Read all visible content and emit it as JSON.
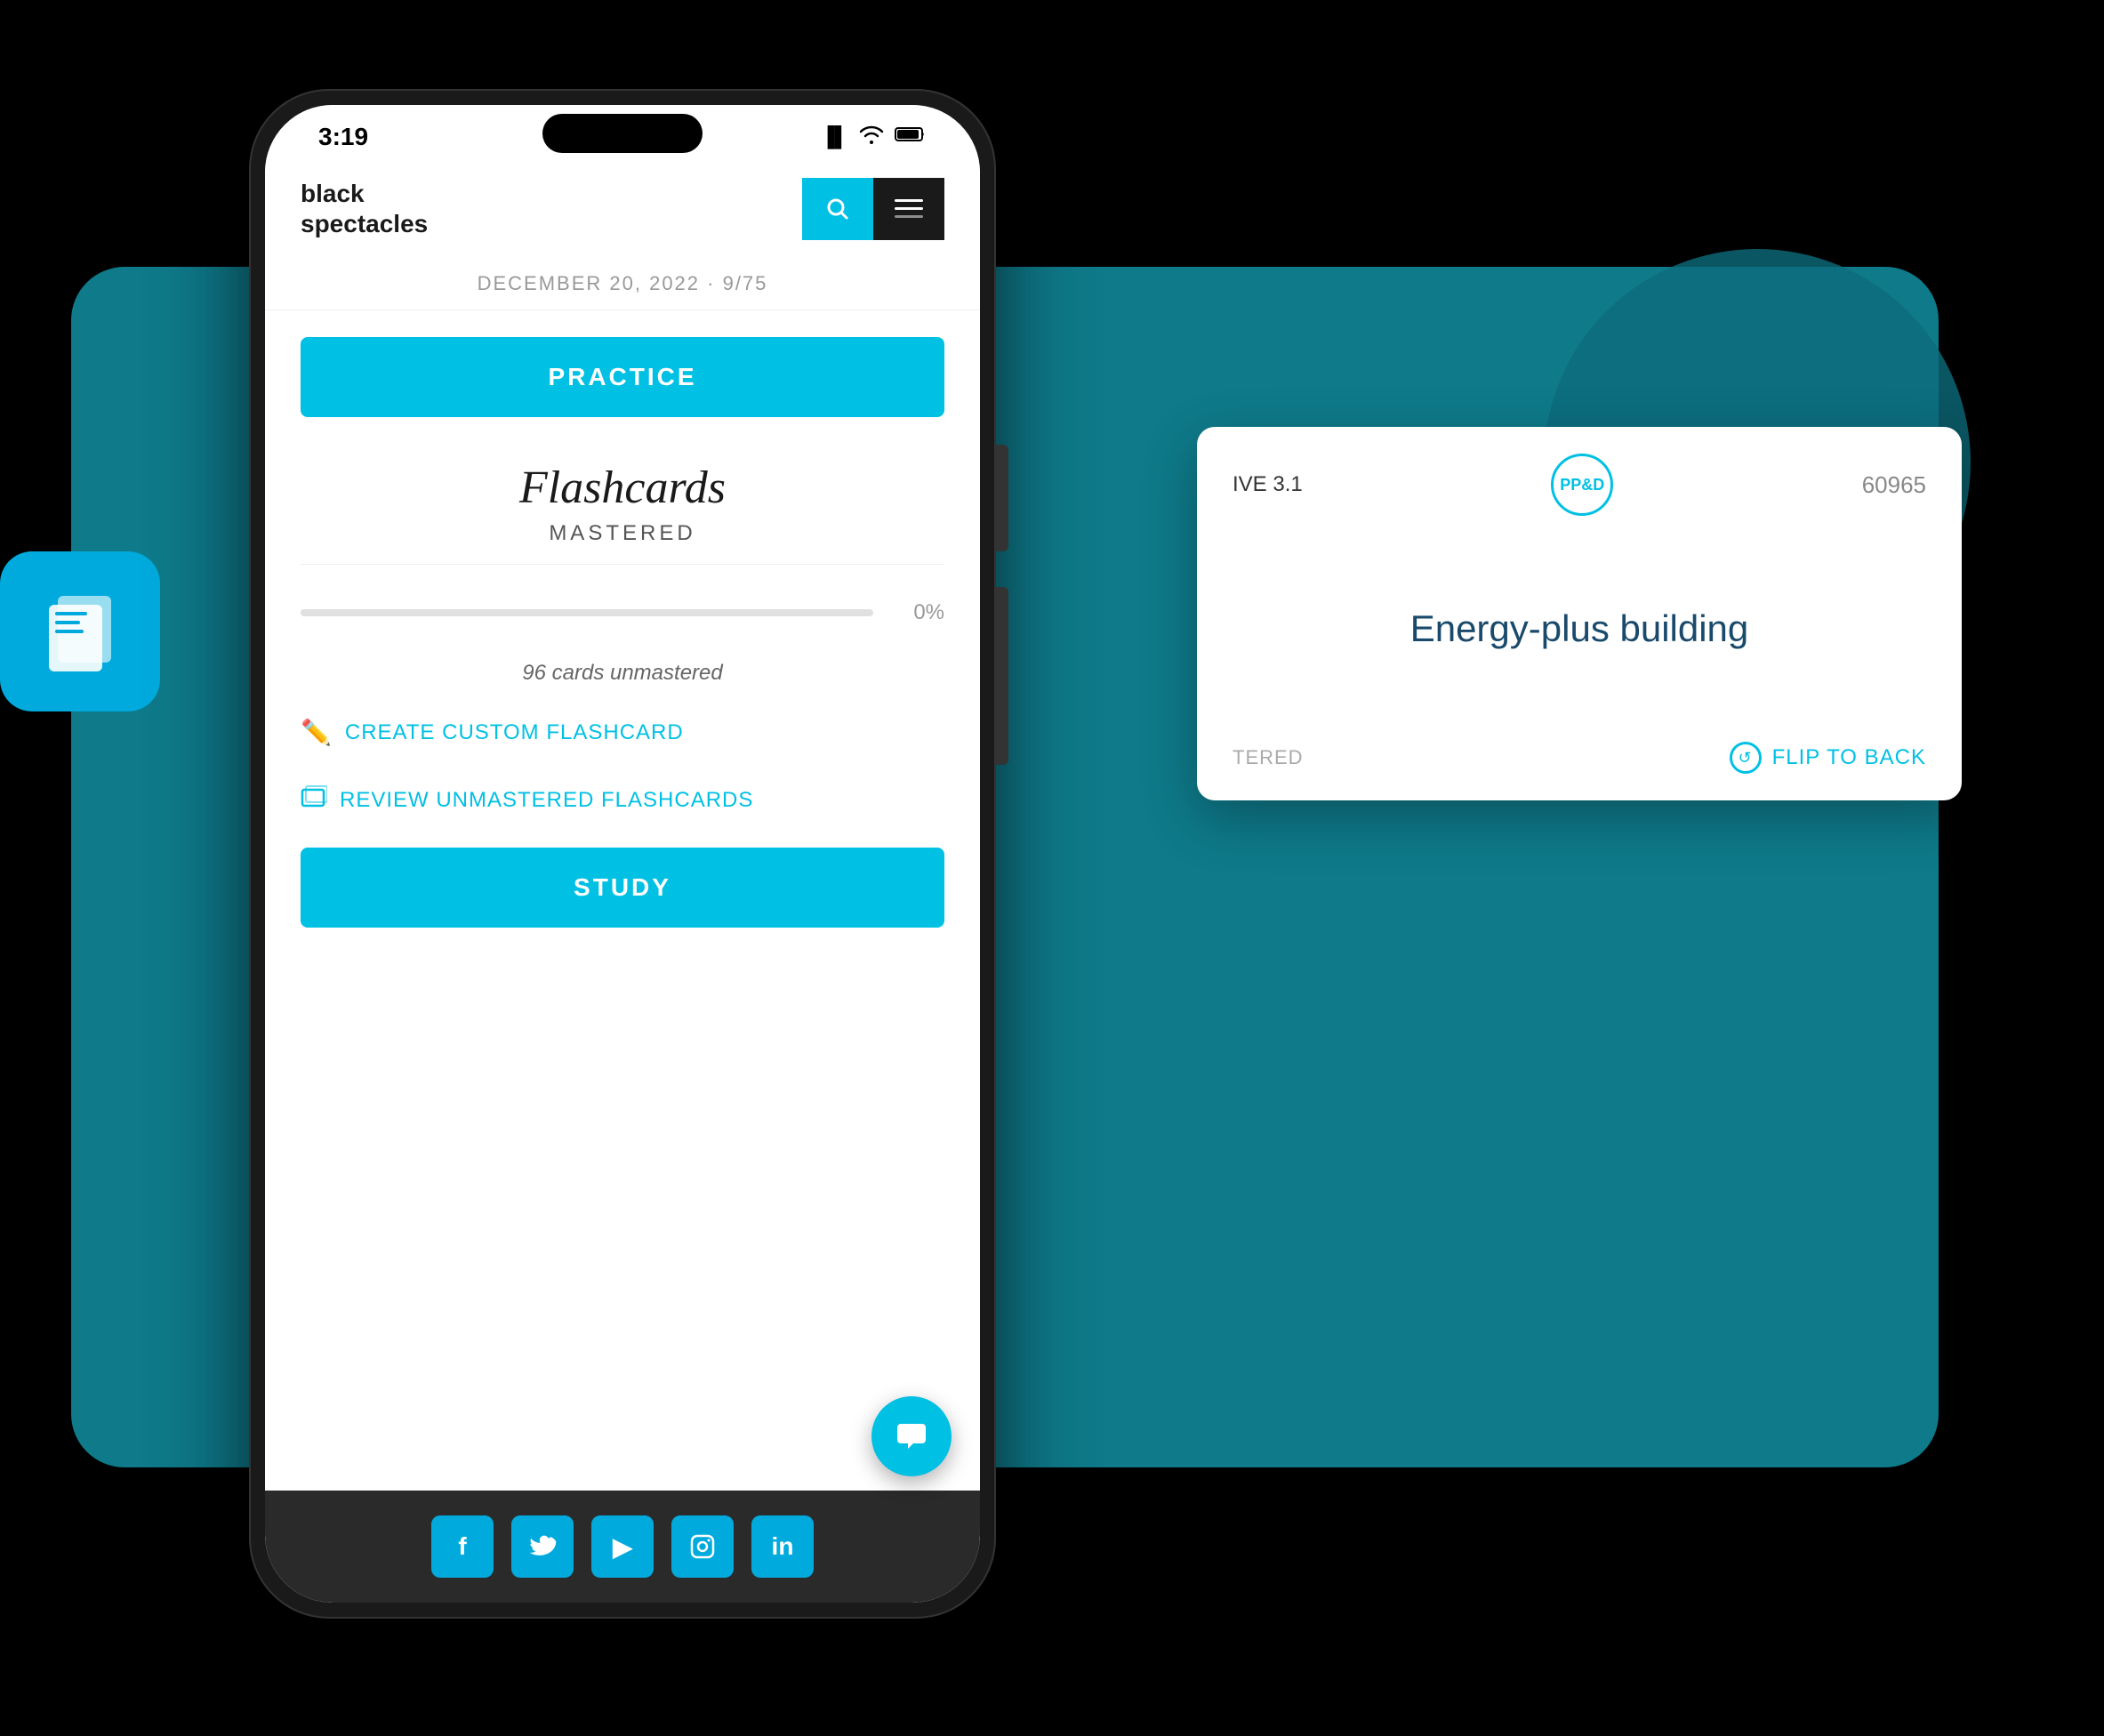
{
  "background": {
    "main_color": "#0e7a8a"
  },
  "phone": {
    "status_bar": {
      "time": "3:19",
      "signal": "●●",
      "wifi": "wifi",
      "battery": "🔋"
    },
    "header": {
      "logo_line1": "black",
      "logo_line2": "spectacles",
      "search_icon": "search",
      "menu_icon": "menu"
    },
    "date_bar": "DECEMBER 20, 2022 · 9/75",
    "practice_btn": "PRACTICE",
    "flashcards_section": {
      "title": "Flashcards",
      "subtitle": "MASTERED",
      "progress_percent": "0%",
      "progress_fill": 0,
      "cards_unmastered": "96 cards unmastered",
      "create_link": "CREATE CUSTOM FLASHCARD",
      "review_link": "REVIEW UNMASTERED FLASHCARDS"
    },
    "study_btn": "STUDY",
    "social_icons": [
      "f",
      "t",
      "▶",
      "◎",
      "in"
    ]
  },
  "flashcard_widget": {
    "category": "IVE 3.1",
    "badge": "PP&D",
    "number": "60965",
    "term": "Energy-plus building",
    "mastered_label": "TERED",
    "flip_label": "FLIP TO BACK"
  },
  "left_widget": {
    "icon": "documents"
  }
}
